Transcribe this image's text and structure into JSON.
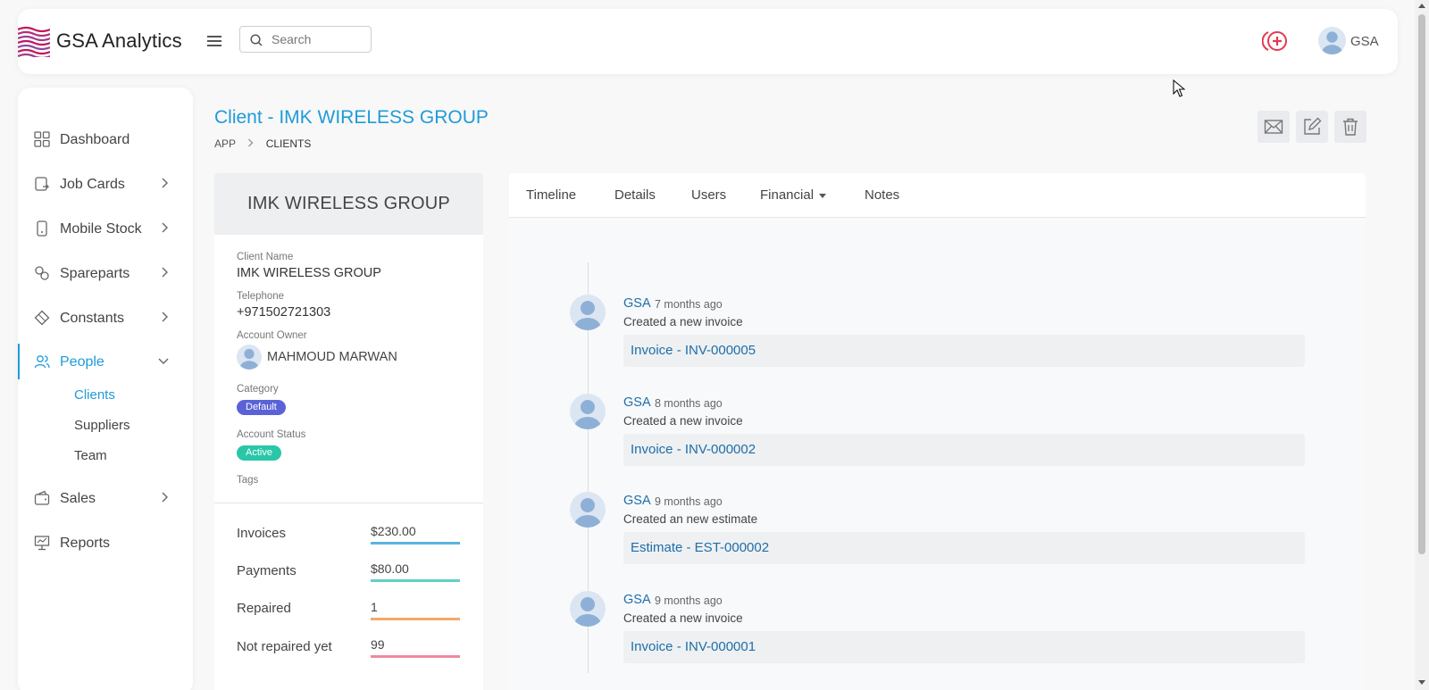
{
  "app": {
    "title": "GSA Analytics",
    "accent": "#1f9bd8"
  },
  "search": {
    "placeholder": "Search"
  },
  "header": {
    "user_name": "GSA"
  },
  "sidebar": {
    "items": [
      {
        "label": "Dashboard",
        "icon": "grid-icon"
      },
      {
        "label": "Job Cards",
        "icon": "job-card-icon"
      },
      {
        "label": "Mobile Stock",
        "icon": "mobile-icon"
      },
      {
        "label": "Spareparts",
        "icon": "spareparts-icon"
      },
      {
        "label": "Constants",
        "icon": "diamond-icon"
      },
      {
        "label": "People",
        "icon": "people-icon"
      },
      {
        "label": "Sales",
        "icon": "wallet-icon"
      },
      {
        "label": "Reports",
        "icon": "presentation-icon"
      }
    ],
    "people_sub": [
      "Clients",
      "Suppliers",
      "Team"
    ]
  },
  "page": {
    "title": "Client - IMK WIRELESS GROUP",
    "breadcrumb": [
      "APP",
      "CLIENTS"
    ]
  },
  "client": {
    "header_name": "IMK WIRELESS GROUP",
    "fields": {
      "name_label": "Client Name",
      "name": "IMK WIRELESS GROUP",
      "phone_label": "Telephone",
      "phone": "+971502721303",
      "owner_label": "Account Owner",
      "owner": "MAHMOUD MARWAN",
      "category_label": "Category",
      "category": "Default",
      "status_label": "Account Status",
      "status": "Active",
      "tags_label": "Tags"
    },
    "stats": [
      {
        "label": "Invoices",
        "value": "$230.00",
        "color": "#5ab4e0"
      },
      {
        "label": "Payments",
        "value": "$80.00",
        "color": "#5fd1c4"
      },
      {
        "label": "Repaired",
        "value": "1",
        "color": "#f5a86a"
      },
      {
        "label": "Not repaired yet",
        "value": "99",
        "color": "#ef8a9c"
      }
    ],
    "category_color": "#5b62d8",
    "status_color": "#29c7a8"
  },
  "tabs": [
    "Timeline",
    "Details",
    "Users",
    "Financial",
    "Notes"
  ],
  "timeline": [
    {
      "user": "GSA",
      "time": "7 months ago",
      "desc": "Created a new invoice",
      "link": "Invoice - INV-000005"
    },
    {
      "user": "GSA",
      "time": "8 months ago",
      "desc": "Created a new invoice",
      "link": "Invoice - INV-000002"
    },
    {
      "user": "GSA",
      "time": "9 months ago",
      "desc": "Created an new estimate",
      "link": "Estimate - EST-000002"
    },
    {
      "user": "GSA",
      "time": "9 months ago",
      "desc": "Created a new invoice",
      "link": "Invoice - INV-000001"
    }
  ]
}
